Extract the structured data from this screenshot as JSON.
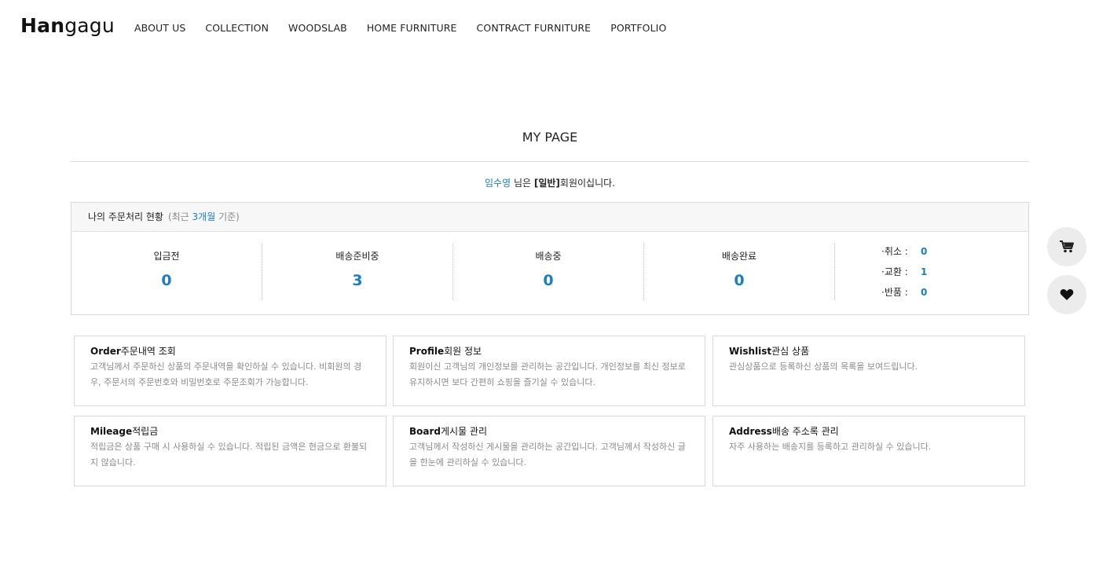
{
  "header": {
    "logo_bold": "Han",
    "logo_light": "gagu",
    "nav": [
      "ABOUT US",
      "COLLECTION",
      "WOODSLAB",
      "HOME FURNITURE",
      "CONTRACT FURNITURE",
      "PORTFOLIO"
    ]
  },
  "page": {
    "title": "MY PAGE",
    "greeting_name": "임수영",
    "greeting_mid": " 님은 ",
    "greeting_grade": "[일반]",
    "greeting_end": "회원이십니다."
  },
  "status": {
    "heading": "나의 주문처리 현황",
    "sub_pre": "(최근 ",
    "sub_hl": "3개월",
    "sub_post": " 기준)",
    "columns": [
      {
        "label": "입금전",
        "value": "0"
      },
      {
        "label": "배송준비중",
        "value": "3"
      },
      {
        "label": "배송중",
        "value": "0"
      },
      {
        "label": "배송완료",
        "value": "0"
      }
    ],
    "side": [
      {
        "label": "·취소 :",
        "value": "0"
      },
      {
        "label": "·교환 :",
        "value": "1"
      },
      {
        "label": "·반품 :",
        "value": "0"
      }
    ]
  },
  "cards": [
    {
      "en": "Order",
      "ko": "주문내역 조회",
      "desc": "고객님께서 주문하신 상품의 주문내역을 확인하실 수 있습니다. 비회원의 경우, 주문서의 주문번호와 비밀번호로 주문조회가 가능합니다."
    },
    {
      "en": "Profile",
      "ko": "회원 정보",
      "desc": "회원이신 고객님의 개인정보를 관리하는 공간입니다. 개인정보를 최신 정보로 유지하시면 보다 간편히 쇼핑을 즐기실 수 있습니다."
    },
    {
      "en": "Wishlist",
      "ko": "관심 상품",
      "desc": "관심상품으로 등록하신 상품의 목록을 보여드립니다."
    },
    {
      "en": "Mileage",
      "ko": "적립금",
      "desc": "적립금은 상품 구매 시 사용하실 수 있습니다. 적립된 금액은 현금으로 환불되지 않습니다."
    },
    {
      "en": "Board",
      "ko": "게시물 관리",
      "desc": "고객님께서 작성하신 게시물을 관리하는 공간입니다. 고객님께서 작성하신 글을 한눈에 관리하실 수 있습니다."
    },
    {
      "en": "Address",
      "ko": "배송 주소록 관리",
      "desc": "자주 사용하는 배송지를 등록하고 관리하실 수 있습니다."
    }
  ],
  "floating": {
    "cart_icon": "cart-icon",
    "wishlist_icon": "heart-icon"
  },
  "colors": {
    "accent": "#1a7fc1",
    "border": "#d9d9d9"
  }
}
